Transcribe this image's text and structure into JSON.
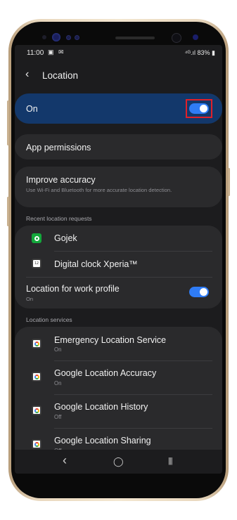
{
  "status_bar": {
    "time": "11:00",
    "left_icons": "▣ ✉",
    "signal": "⁴ᴳ.ıl",
    "battery": "83%"
  },
  "header": {
    "title": "Location",
    "back_icon": "chevron-left-icon"
  },
  "master_toggle": {
    "label": "On",
    "state": true
  },
  "app_permissions": {
    "label": "App permissions"
  },
  "improve_accuracy": {
    "title": "Improve accuracy",
    "subtitle": "Use Wi-Fi and Bluetooth for more accurate location detection."
  },
  "recent_requests": {
    "label": "Recent location requests",
    "items": [
      {
        "name": "Gojek"
      },
      {
        "name": "Digital clock Xperia™"
      }
    ]
  },
  "work_profile": {
    "title": "Location for work profile",
    "subtitle": "On",
    "state": true
  },
  "location_services": {
    "label": "Location services",
    "items": [
      {
        "name": "Emergency Location Service",
        "status": "On"
      },
      {
        "name": "Google Location Accuracy",
        "status": "On"
      },
      {
        "name": "Google Location History",
        "status": "Off"
      },
      {
        "name": "Google Location Sharing",
        "status": "Off"
      }
    ]
  },
  "nav": {
    "back": "‹",
    "home": "◯",
    "recents": "|||"
  },
  "colors": {
    "accent": "#2f7cf6",
    "on_card": "#13386b",
    "highlight": "#e0202a",
    "background": "#1c1c1e",
    "card": "#2a2a2c"
  }
}
